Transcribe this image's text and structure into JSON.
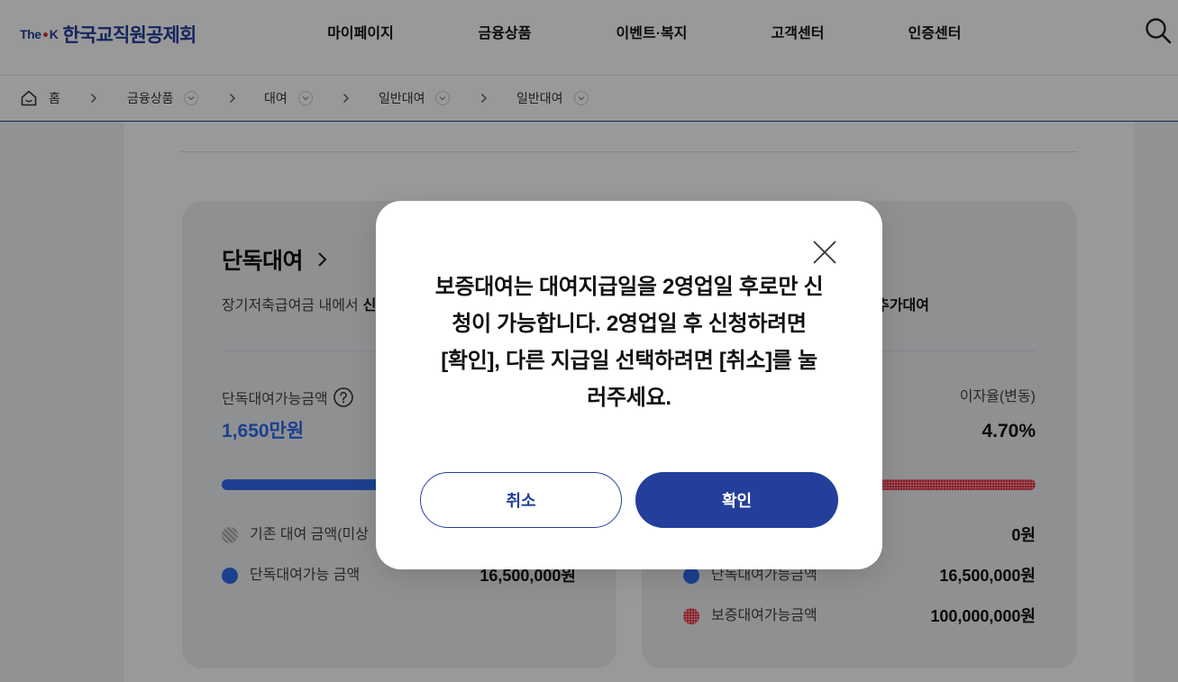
{
  "colors": {
    "navy": "#243f9b",
    "blue": "#2f6cee",
    "red": "#ec2e42",
    "card_bg": "#eef0f4",
    "page_bg": "#f3f4f6",
    "overlay": "rgba(0, 0, 0, 0.4)"
  },
  "header": {
    "logo": {
      "brand_prefix": "The",
      "brand_mark": "K",
      "name": "한국교직원공제회"
    },
    "nav": [
      "마이페이지",
      "금융상품",
      "이벤트·복지",
      "고객센터",
      "인증센터"
    ],
    "search_icon": "search-icon"
  },
  "breadcrumb": {
    "home_icon": "home-icon",
    "home": "홈",
    "separator_icon": "chevron-right-icon",
    "dropdown_icon": "chevron-down-icon",
    "items": [
      {
        "label": "금융상품"
      },
      {
        "label": "대여"
      },
      {
        "label": "일반대여"
      },
      {
        "label": "일반대여"
      }
    ]
  },
  "solo_card": {
    "title": "단독대여",
    "title_icon": "chevron-right-icon",
    "description": "장기저축급여금 내에서",
    "description_bold": "신",
    "available_label": "단독대여가능금액",
    "help_icon": "question-circle-icon",
    "available_amount": "1,650만원",
    "legend": [
      {
        "icon": "striped-gray-dot-icon",
        "label": "기존 대여 금액(미상"
      },
      {
        "icon": "blue-dot-icon",
        "label": "단독대여가능 금액",
        "value": "16,500,000원"
      }
    ]
  },
  "guarantee_card": {
    "description_bold": "추가대여",
    "rate_label": "이자율(변동)",
    "rate_value": "4.70%",
    "legend": [
      {
        "value": "0원"
      },
      {
        "icon": "blue-dot-icon",
        "label": "단독대여가능금액",
        "value": "16,500,000원"
      },
      {
        "icon": "red-check-dot-icon",
        "label": "보증대여가능금액",
        "value": "100,000,000원"
      }
    ]
  },
  "modal": {
    "close_icon": "close-icon",
    "message_lines": [
      "보증대여는 대여지급일을 2영업일 후로만 신",
      "청이 가능합니다. 2영업일 후 신청하려면",
      "[확인], 다른 지급일 선택하려면 [취소]를 눌",
      "러주세요."
    ],
    "cancel_label": "취소",
    "confirm_label": "확인"
  }
}
